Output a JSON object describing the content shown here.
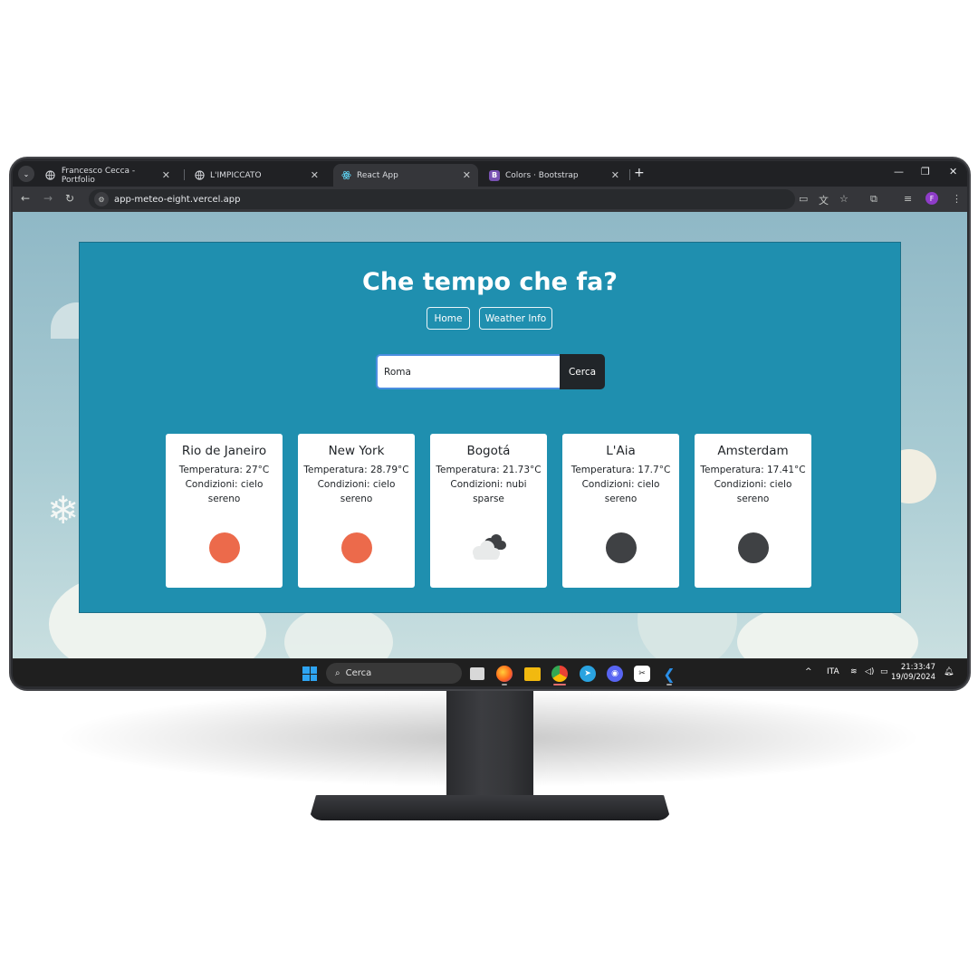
{
  "browser": {
    "tabs": [
      {
        "label": "Francesco Cecca - Portfolio",
        "active": false
      },
      {
        "label": "L'IMPICCATO",
        "active": false
      },
      {
        "label": "React App",
        "active": true
      },
      {
        "label": "Colors · Bootstrap",
        "active": false
      }
    ],
    "favicon_bootstrap_letter": "B",
    "url": "app-meteo-eight.vercel.app",
    "profile_initial": "F"
  },
  "app": {
    "title": "Che tempo che fa?",
    "nav": [
      {
        "label": "Home"
      },
      {
        "label": "Weather Info"
      }
    ],
    "search": {
      "value": "Roma",
      "button_label": "Cerca"
    },
    "cards": [
      {
        "city": "Rio de Janeiro",
        "temperature": "Temperatura: 27°C",
        "conditions": "Condizioni: cielo sereno",
        "icon": "sun-icon",
        "color": "#ec6a4b"
      },
      {
        "city": "New York",
        "temperature": "Temperatura: 28.79°C",
        "conditions": "Condizioni: cielo sereno",
        "icon": "sun-icon",
        "color": "#ec6a4b"
      },
      {
        "city": "Bogotá",
        "temperature": "Temperatura: 21.73°C",
        "conditions": "Condizioni: nubi sparse",
        "icon": "scattered-clouds-icon",
        "color": "#3f4144"
      },
      {
        "city": "L'Aia",
        "temperature": "Temperatura: 17.7°C",
        "conditions": "Condizioni: cielo sereno",
        "icon": "moon-icon",
        "color": "#3f4144"
      },
      {
        "city": "Amsterdam",
        "temperature": "Temperatura: 17.41°C",
        "conditions": "Condizioni: cielo sereno",
        "icon": "moon-icon",
        "color": "#3f4144"
      }
    ]
  },
  "taskbar": {
    "search_placeholder": "Cerca",
    "language": "ITA",
    "time": "21:33:47",
    "date": "19/09/2024"
  },
  "colors": {
    "app_background": "#1f8faf",
    "search_button": "#212529",
    "sun": "#ec6a4b",
    "moon": "#3f4144",
    "input_focus": "#4b8ee0"
  }
}
